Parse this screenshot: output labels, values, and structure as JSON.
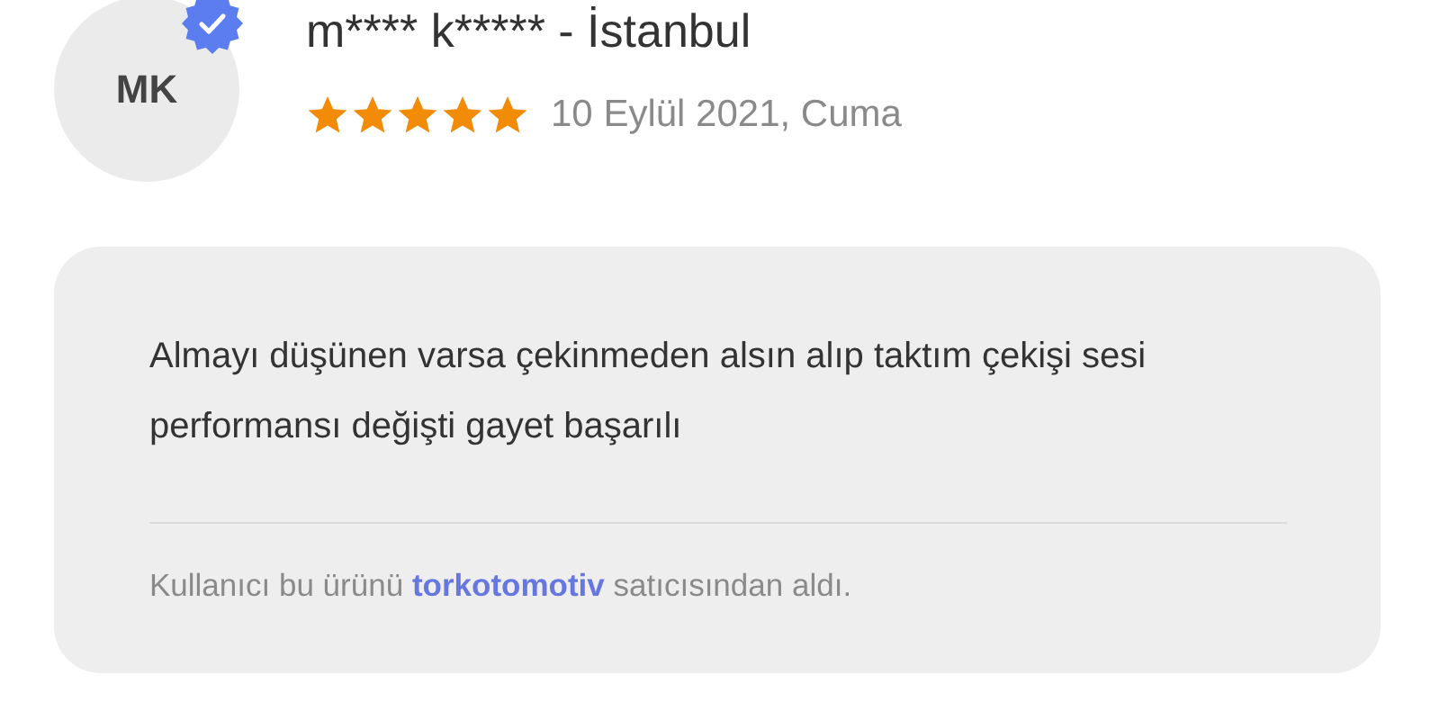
{
  "reviewer": {
    "initials": "MK",
    "verified": true,
    "name": "m**** k***** - İstanbul",
    "stars": 5,
    "date": "10 Eylül 2021, Cuma"
  },
  "review": {
    "text": "Almayı düşünen varsa çekinmeden alsın alıp taktım çekişi sesi performansı değişti gayet başarılı",
    "purchase_note": {
      "before": "Kullanıcı bu ürünü",
      "seller": "torkotomotiv",
      "after": "satıcısından aldı."
    }
  }
}
